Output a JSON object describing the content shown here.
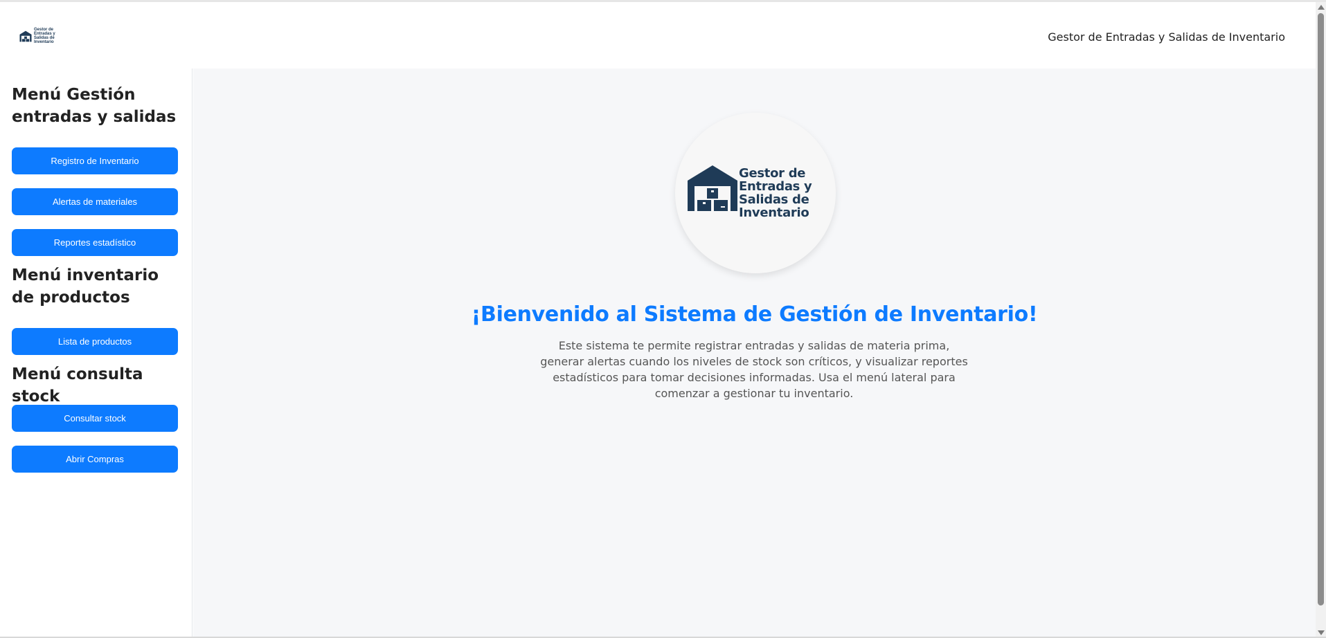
{
  "header": {
    "logo_text": [
      "Gestor de",
      "Entradas y",
      "Salidas de",
      "Inventario"
    ],
    "title": "Gestor de Entradas y Salidas de Inventario"
  },
  "sidebar": {
    "sections": [
      {
        "heading": "Menú Gestión entradas y salidas",
        "buttons": [
          "Registro de Inventario",
          "Alertas de materiales",
          "Reportes estadístico"
        ]
      },
      {
        "heading": "Menú inventario de productos",
        "buttons": [
          "Lista de productos"
        ]
      },
      {
        "heading": "Menú consulta stock",
        "buttons": [
          "Consultar stock",
          "Abrir Compras"
        ]
      }
    ]
  },
  "main": {
    "logo_text": [
      "Gestor de",
      "Entradas y",
      "Salidas de",
      "Inventario"
    ],
    "welcome_title": "¡Bienvenido al Sistema de Gestión de Inventario!",
    "welcome_description": "Este sistema te permite registrar entradas y salidas de materia prima, generar alertas cuando los niveles de stock son críticos, y visualizar reportes estadísticos para tomar decisiones informadas. Usa el menú lateral para comenzar a gestionar tu inventario."
  },
  "colors": {
    "accent": "#0d7bff",
    "logo_navy": "#1f3b57",
    "main_background": "#f6f7f9"
  },
  "icons": {
    "brand_logo": "warehouse-icon"
  }
}
